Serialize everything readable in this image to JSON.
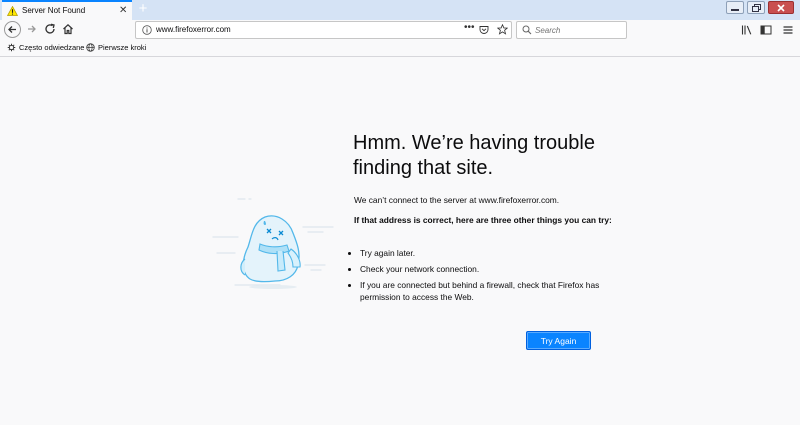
{
  "tab": {
    "title": "Server Not Found"
  },
  "nav": {
    "url": "www.firefoxerror.com",
    "search_placeholder": "Search",
    "page_actions": "•••"
  },
  "bookmarks": [
    {
      "label": "Często odwiedzane",
      "icon": "gear-icon"
    },
    {
      "label": "Pierwsze kroki",
      "icon": "globe-icon"
    }
  ],
  "error": {
    "title": "Hmm. We’re having trouble finding that site.",
    "description": "We can’t connect to the server at www.firefoxerror.com.",
    "suggestion_heading": "If that address is correct, here are three other things you can try:",
    "suggestions": [
      "Try again later.",
      "Check your network connection.",
      "If you are connected but behind a firewall, check that Firefox has permission to access the Web."
    ],
    "button_label": "Try Again"
  },
  "colors": {
    "accent": "#0a84ff",
    "tabstrip": "#d5e3f5",
    "page_bg": "#f9f9fa"
  }
}
